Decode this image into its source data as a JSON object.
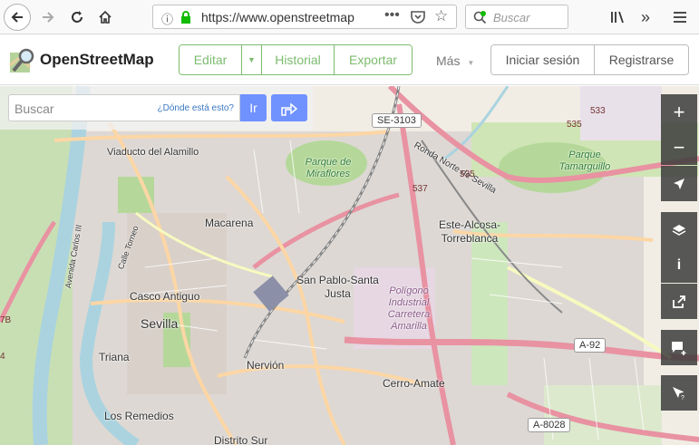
{
  "browser": {
    "url": "https://www.openstreetmap",
    "search_placeholder": "Buscar"
  },
  "header": {
    "logo_text": "OpenStreetMap",
    "edit_label": "Editar",
    "history_label": "Historial",
    "export_label": "Exportar",
    "more_label": "Más",
    "login_label": "Iniciar sesión",
    "signup_label": "Registrarse"
  },
  "search": {
    "placeholder": "Buscar",
    "where_label": "¿Dónde está esto?",
    "go_label": "Ir"
  },
  "map": {
    "labels": {
      "viaducto": "Viaducto del Alamillo",
      "macarena": "Macarena",
      "casco": "Casco Antiguo",
      "sevilla": "Sevilla",
      "triana": "Triana",
      "remedios": "Los Remedios",
      "distrito_sur": "Distrito Sur",
      "nervion": "Nervión",
      "san_pablo": "San Pablo-Santa Justa",
      "este": "Este-Alcosa-Torreblanca",
      "cerro": "Cerro-Amate",
      "poligono": "Polígono Industrial Carretera Amarilla",
      "parque_miraflores": "Parque de Miraflores",
      "parque_tamarguillo": "Parque Tamarguillo",
      "ronda": "Ronda Norte de Sevilla",
      "calle_torneo": "Calle Torneo",
      "avenida": "Avenida Carlos III"
    },
    "roads": {
      "se3103": "SE-3103",
      "a92": "A-92",
      "a8028": "A-8028",
      "r535a": "535",
      "r535b": "535",
      "r533": "533",
      "r537": "537",
      "r7b": "7B",
      "r4": "4"
    }
  },
  "controls": {
    "zoom_in": "+",
    "zoom_out": "−"
  }
}
